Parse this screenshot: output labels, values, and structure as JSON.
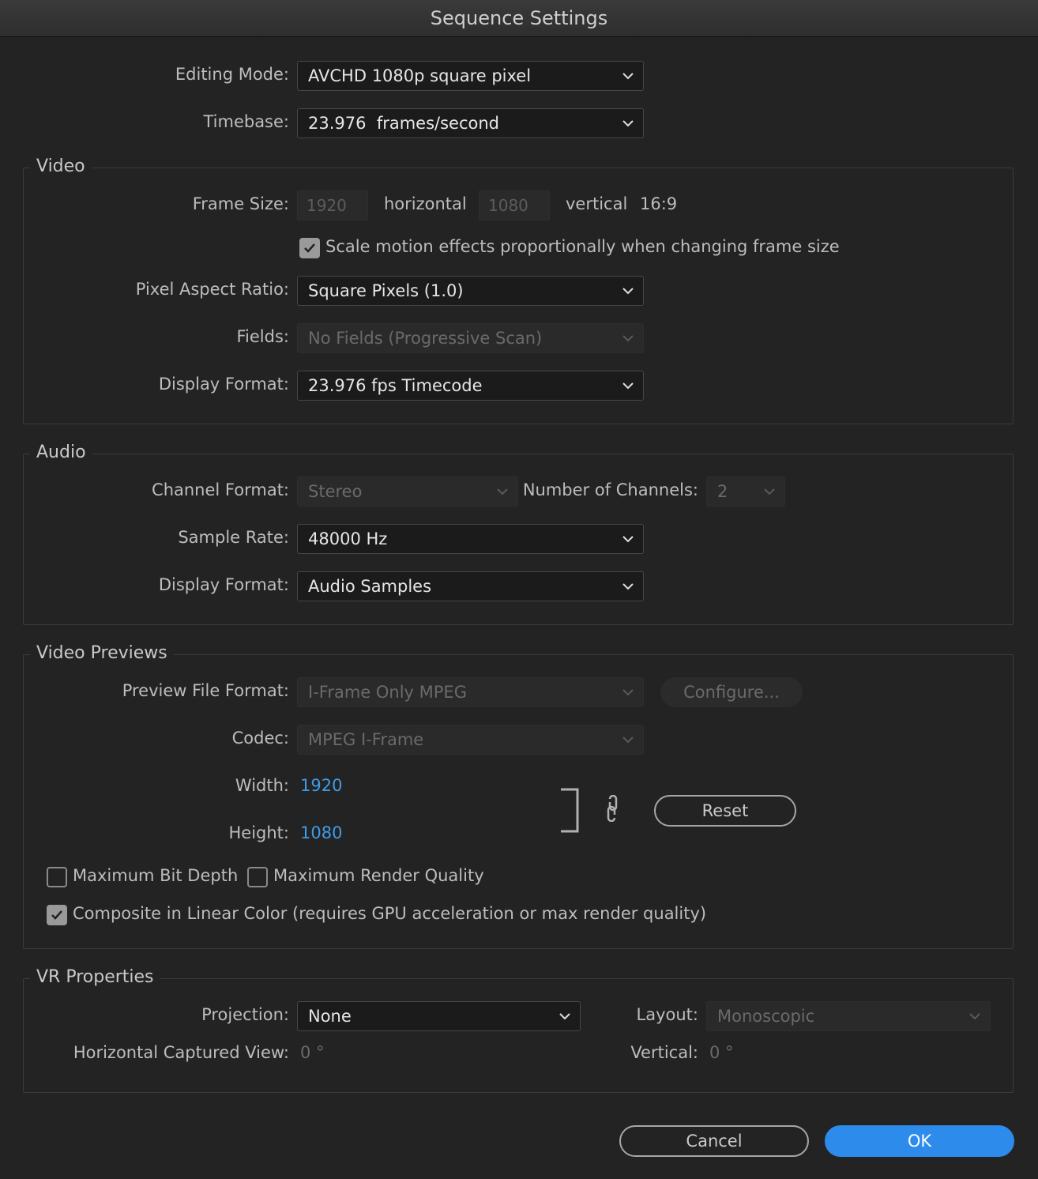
{
  "window": {
    "title": "Sequence Settings"
  },
  "top": {
    "editing_mode": {
      "label": "Editing Mode:",
      "value": "AVCHD 1080p square pixel"
    },
    "timebase": {
      "label": "Timebase:",
      "value": "23.976  frames/second"
    }
  },
  "video": {
    "title": "Video",
    "frame_size": {
      "label": "Frame Size:",
      "width": "1920",
      "horizontal_label": "horizontal",
      "height": "1080",
      "vertical_label": "vertical",
      "aspect": "16:9"
    },
    "scale_motion": {
      "label": "Scale motion effects proportionally when changing frame size",
      "checked": true
    },
    "pixel_aspect": {
      "label": "Pixel Aspect Ratio:",
      "value": "Square Pixels (1.0)"
    },
    "fields": {
      "label": "Fields:",
      "value": "No Fields (Progressive Scan)"
    },
    "display_format": {
      "label": "Display Format:",
      "value": "23.976 fps Timecode"
    }
  },
  "audio": {
    "title": "Audio",
    "channel_format": {
      "label": "Channel Format:",
      "value": "Stereo"
    },
    "num_channels": {
      "label": "Number of Channels:",
      "value": "2"
    },
    "sample_rate": {
      "label": "Sample Rate:",
      "value": "48000 Hz"
    },
    "display_format": {
      "label": "Display Format:",
      "value": "Audio Samples"
    }
  },
  "previews": {
    "title": "Video Previews",
    "file_format": {
      "label": "Preview File Format:",
      "value": "I-Frame Only MPEG"
    },
    "configure_label": "Configure...",
    "codec": {
      "label": "Codec:",
      "value": "MPEG I-Frame"
    },
    "width": {
      "label": "Width:",
      "value": "1920"
    },
    "height": {
      "label": "Height:",
      "value": "1080"
    },
    "reset_label": "Reset",
    "max_bit_depth": {
      "label": "Maximum Bit Depth",
      "checked": false
    },
    "max_render_quality": {
      "label": "Maximum Render Quality",
      "checked": false
    },
    "linear_color": {
      "label": "Composite in Linear Color (requires GPU acceleration or max render quality)",
      "checked": true
    }
  },
  "vr": {
    "title": "VR Properties",
    "projection": {
      "label": "Projection:",
      "value": "None"
    },
    "layout": {
      "label": "Layout:",
      "value": "Monoscopic"
    },
    "horizontal_view": {
      "label": "Horizontal Captured View:",
      "value": "0 °"
    },
    "vertical": {
      "label": "Vertical:",
      "value": "0 °"
    }
  },
  "footer": {
    "cancel_label": "Cancel",
    "ok_label": "OK"
  },
  "colors": {
    "accent": "#2d8ceb",
    "link_value": "#3e9ce8",
    "background": "#232323"
  }
}
